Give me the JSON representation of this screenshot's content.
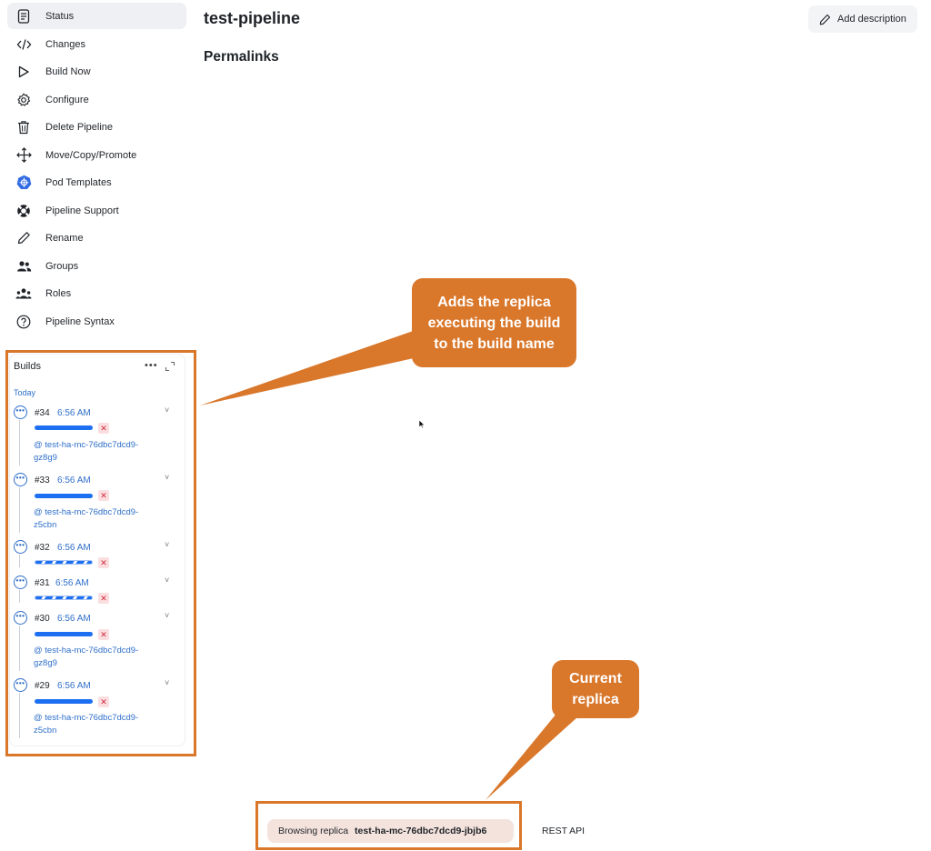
{
  "sidebar": {
    "items": [
      {
        "label": "Status",
        "icon": "document-icon"
      },
      {
        "label": "Changes",
        "icon": "code-icon"
      },
      {
        "label": "Build Now",
        "icon": "play-icon"
      },
      {
        "label": "Configure",
        "icon": "gear-icon"
      },
      {
        "label": "Delete Pipeline",
        "icon": "trash-icon"
      },
      {
        "label": "Move/Copy/Promote",
        "icon": "move-arrows-icon"
      },
      {
        "label": "Pod Templates",
        "icon": "kubernetes-icon"
      },
      {
        "label": "Pipeline Support",
        "icon": "lifebuoy-icon"
      },
      {
        "label": "Rename",
        "icon": "pencil-icon"
      },
      {
        "label": "Groups",
        "icon": "people-icon"
      },
      {
        "label": "Roles",
        "icon": "roles-icon"
      },
      {
        "label": "Pipeline Syntax",
        "icon": "help-circle-icon"
      }
    ]
  },
  "main": {
    "title": "test-pipeline",
    "section_title": "Permalinks",
    "add_description_label": "Add description"
  },
  "builds": {
    "title": "Builds",
    "more_label": "•••",
    "group_label": "Today",
    "items": [
      {
        "number": "#34",
        "time": "6:56 AM",
        "progress": "complete",
        "replica_line1": "@ test-ha-mc-76dbc7dcd9-",
        "replica_line2": "gz8g9"
      },
      {
        "number": "#33",
        "time": "6:56 AM",
        "progress": "complete",
        "replica_line1": "@ test-ha-mc-76dbc7dcd9-",
        "replica_line2": "z5cbn"
      },
      {
        "number": "#32",
        "time": "6:56 AM",
        "progress": "indeterminate"
      },
      {
        "number": "#31",
        "time": "6:56 AM",
        "progress": "indeterminate"
      },
      {
        "number": "#30",
        "time": "6:56 AM",
        "progress": "complete",
        "replica_line1": "@ test-ha-mc-76dbc7dcd9-",
        "replica_line2": "gz8g9"
      },
      {
        "number": "#29",
        "time": "6:56 AM",
        "progress": "complete",
        "replica_line1": "@ test-ha-mc-76dbc7dcd9-",
        "replica_line2": "z5cbn"
      }
    ],
    "stop_glyph": "✕",
    "chevron_glyph": "˅",
    "running_glyph": "•••"
  },
  "callouts": {
    "replica_build_name": [
      "Adds the replica",
      "executing the build",
      "to the build name"
    ],
    "current_replica": [
      "Current",
      "replica"
    ]
  },
  "footer": {
    "browsing_prefix": "Browsing replica",
    "replica_name": "test-ha-mc-76dbc7dcd9-jbjb6",
    "rest_api_label": "REST API"
  },
  "colors": {
    "annotation_orange": "#d9772b",
    "link_blue": "#2f6fc9",
    "progress_blue": "#1d6ff2",
    "stop_red": "#d2283b"
  }
}
